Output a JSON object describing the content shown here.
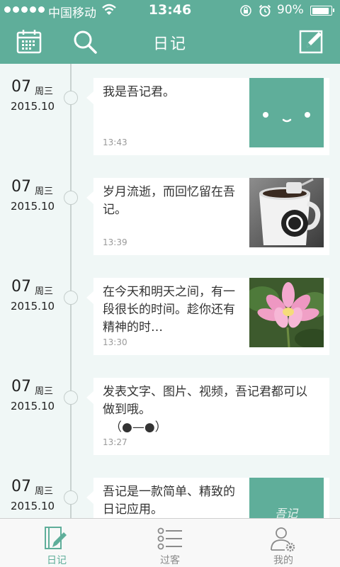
{
  "status_bar": {
    "carrier": "中国移动",
    "time": "13:46",
    "battery_percent": "90%",
    "battery_level": 0.9,
    "icons": [
      "signal-dots-icon",
      "wifi-icon",
      "rotation-lock-icon",
      "alarm-icon",
      "battery-icon"
    ]
  },
  "nav": {
    "title": "日记",
    "left_icons": [
      "calendar-icon",
      "search-icon"
    ],
    "right_icon": "compose-icon"
  },
  "colors": {
    "accent": "#5fae9a",
    "timeline_bg": "#f0f7f6",
    "tab_active": "#5fae9a",
    "tab_inactive": "#8a8a8a"
  },
  "entries": [
    {
      "day": "07",
      "weekday": "周三",
      "year": "2015.10",
      "text": "我是吾记君。",
      "time": "13:43",
      "image": "green-face-thumbnail"
    },
    {
      "day": "07",
      "weekday": "周三",
      "year": "2015.10",
      "text": "岁月流逝，而回忆留在吾记。",
      "time": "13:39",
      "image": "coffee-cup-photo"
    },
    {
      "day": "07",
      "weekday": "周三",
      "year": "2015.10",
      "text": "在今天和明天之间，有一段很长的时间。趁你还有精神的时…",
      "time": "13:30",
      "image": "lotus-flower-photo"
    },
    {
      "day": "07",
      "weekday": "周三",
      "year": "2015.10",
      "text": "发表文字、图片、视频，吾记君都可以做到哦。",
      "text_extra": "（●—●）",
      "time": "13:27",
      "image": null
    },
    {
      "day": "07",
      "weekday": "周三",
      "year": "2015.10",
      "text": "吾记是一款简单、精致的日记应用。",
      "time": "",
      "image": "green-calligraphy-thumbnail",
      "image_text": "吾记"
    }
  ],
  "tabs": [
    {
      "label": "日记",
      "icon": "diary-notebook-icon",
      "active": true
    },
    {
      "label": "过客",
      "icon": "list-icon",
      "active": false
    },
    {
      "label": "我的",
      "icon": "profile-settings-icon",
      "active": false
    }
  ]
}
